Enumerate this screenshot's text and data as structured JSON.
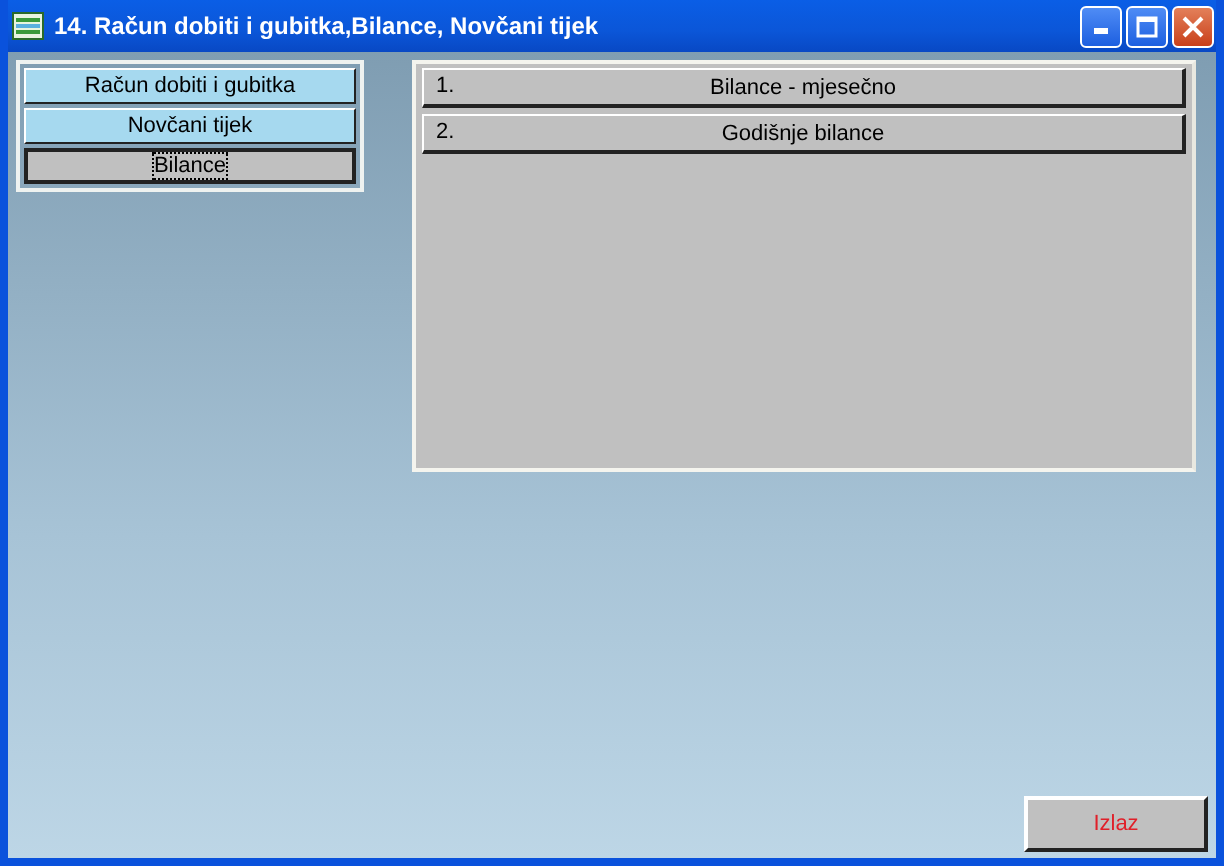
{
  "window": {
    "title": "14. Račun dobiti i gubitka,Bilance, Novčani tijek"
  },
  "categories": [
    {
      "label": "Račun dobiti i gubitka",
      "selected": false
    },
    {
      "label": "Novčani tijek",
      "selected": false
    },
    {
      "label": "Bilance",
      "selected": true
    }
  ],
  "reports": [
    {
      "number": "1.",
      "label": "Bilance - mjesečno"
    },
    {
      "number": "2.",
      "label": "Godišnje bilance"
    }
  ],
  "exit_button": "Izlaz"
}
